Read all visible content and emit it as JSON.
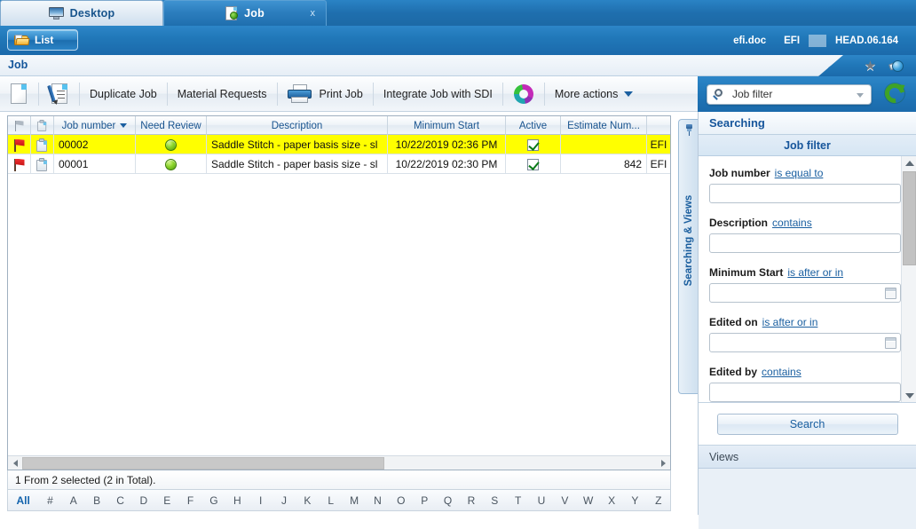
{
  "window_tabs": [
    {
      "label": "Desktop",
      "icon": "monitor-icon",
      "active": false,
      "close": ""
    },
    {
      "label": "Job",
      "icon": "job-document-icon",
      "active": true,
      "close": "x"
    }
  ],
  "header": {
    "list_button": "List",
    "list_icon": "folder-icon",
    "user_doc": "efi.doc",
    "company": "EFI",
    "version": "HEAD.06.164"
  },
  "page": {
    "title": "Job",
    "star_icon": "star-icon",
    "globe_icon": "globe-icon"
  },
  "toolbar": {
    "new_icon": "new-document-icon",
    "edit_icon": "edit-document-icon",
    "duplicate_job": "Duplicate Job",
    "material_requests": "Material Requests",
    "print_job": "Print Job",
    "print_icon": "printer-icon",
    "integrate_job": "Integrate Job with SDI",
    "sdi_icon": "sdi-circle-icon",
    "more_actions": "More actions",
    "more_actions_caret": "chevron-down-icon"
  },
  "filter": {
    "value": "Job filter",
    "placeholder": "Job filter",
    "search_icon": "search-icon",
    "caret_icon": "chevron-down-icon",
    "refresh_icon": "refresh-icon"
  },
  "grid": {
    "columns": [
      {
        "label": "",
        "icon": "flag-column-icon"
      },
      {
        "label": "",
        "icon": "clipboard-column-icon"
      },
      {
        "label": "Job number",
        "sorted": true,
        "sort_dir": "desc"
      },
      {
        "label": "Need Review"
      },
      {
        "label": "Description"
      },
      {
        "label": "Minimum Start"
      },
      {
        "label": "Active"
      },
      {
        "label": "Estimate Num..."
      },
      {
        "label": ""
      }
    ],
    "rows": [
      {
        "selected": true,
        "flag": "red-flag-icon",
        "clip": "clipboard-icon",
        "job_number": "00002",
        "need_review": "green-led-icon",
        "description": "Saddle Stitch - paper basis size - sl",
        "minimum_start": "10/22/2019 02:36 PM",
        "active": true,
        "estimate_number": "",
        "owner": "EFI"
      },
      {
        "selected": false,
        "flag": "red-flag-icon",
        "clip": "clipboard-icon",
        "job_number": "00001",
        "need_review": "green-led-icon",
        "description": "Saddle Stitch - paper basis size - sl",
        "minimum_start": "10/22/2019 02:30 PM",
        "active": true,
        "estimate_number": "842",
        "owner": "EFI"
      }
    ]
  },
  "status": {
    "text": "1 From 2 selected (2 in Total)."
  },
  "alphabet": [
    "All",
    "#",
    "A",
    "B",
    "C",
    "D",
    "E",
    "F",
    "G",
    "H",
    "I",
    "J",
    "K",
    "L",
    "M",
    "N",
    "O",
    "P",
    "Q",
    "R",
    "S",
    "T",
    "U",
    "V",
    "W",
    "X",
    "Y",
    "Z"
  ],
  "side_tab": {
    "label": "Searching & Views",
    "pin_icon": "pin-icon"
  },
  "search_panel": {
    "title": "Searching",
    "subtitle": "Job filter",
    "fields": [
      {
        "label": "Job number",
        "operator": "is equal to",
        "value": "",
        "placeholder": "",
        "type": "text"
      },
      {
        "label": "Description",
        "operator": "contains",
        "value": "",
        "placeholder": "",
        "type": "text"
      },
      {
        "label": "Minimum Start",
        "operator": "is after or in",
        "value": "",
        "placeholder": "",
        "type": "date"
      },
      {
        "label": "Edited on",
        "operator": "is after or in",
        "value": "",
        "placeholder": "",
        "type": "date"
      },
      {
        "label": "Edited by",
        "operator": "contains",
        "value": "",
        "placeholder": "",
        "type": "text"
      }
    ],
    "search_button": "Search",
    "views_label": "Views",
    "scroll_up_icon": "scroll-up-icon",
    "scroll_down_icon": "scroll-down-icon"
  },
  "colors": {
    "brand_blue": "#2178b9",
    "link_blue": "#1a5fa0",
    "title_blue": "#16559b",
    "selected_row": "#ffff00",
    "led_green": "#8bd42a",
    "refresh_green": "#3fa326"
  }
}
